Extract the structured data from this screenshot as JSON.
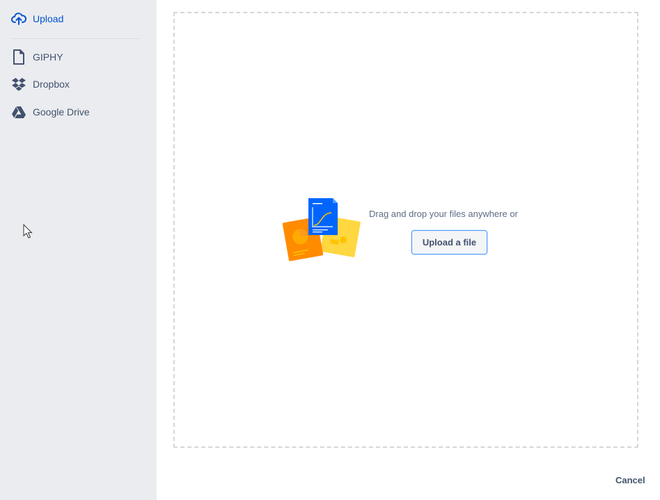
{
  "sidebar": {
    "items": [
      {
        "label": "Upload",
        "icon": "cloud-upload-icon",
        "active": true
      },
      {
        "label": "GIPHY",
        "icon": "file-icon",
        "active": false
      },
      {
        "label": "Dropbox",
        "icon": "dropbox-icon",
        "active": false
      },
      {
        "label": "Google Drive",
        "icon": "google-drive-icon",
        "active": false
      }
    ]
  },
  "dropzone": {
    "text": "Drag and drop your files anywhere or",
    "button_label": "Upload a file"
  },
  "footer": {
    "cancel_label": "Cancel"
  },
  "colors": {
    "sidebar_bg": "#ebecf0",
    "active": "#0052cc",
    "text": "#42526e",
    "button_border": "#4c9aff"
  }
}
